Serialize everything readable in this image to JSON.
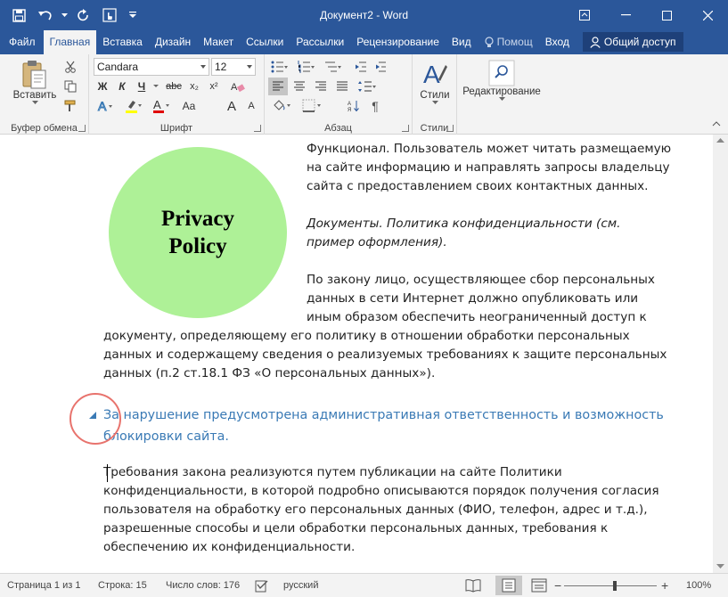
{
  "window": {
    "title": "Документ2 - Word",
    "controls": [
      "restore-ribbon-icon",
      "minimize-icon",
      "maximize-icon",
      "close-icon"
    ]
  },
  "quick_access": [
    "save-icon",
    "undo-icon",
    "redo-icon",
    "touch-mode-icon",
    "customize-icon"
  ],
  "tabs": {
    "file": "Файл",
    "home": "Главная",
    "insert": "Вставка",
    "design": "Дизайн",
    "layout": "Макет",
    "references": "Ссылки",
    "mailings": "Рассылки",
    "review": "Рецензирование",
    "view": "Вид",
    "tell_me": "Помощ",
    "sign_in": "Вход",
    "share": "Общий доступ"
  },
  "ribbon": {
    "clipboard": {
      "paste": "Вставить",
      "label": "Буфер обмена"
    },
    "font": {
      "name": "Candara",
      "size": "12",
      "label": "Шрифт",
      "bold": "Ж",
      "italic": "К",
      "underline": "Ч",
      "strike": "abc",
      "subscript": "x₂",
      "superscript": "x²",
      "grow": "A",
      "shrink": "A",
      "case": "Aa"
    },
    "paragraph": {
      "label": "Абзац"
    },
    "styles": {
      "button": "Стили",
      "label": "Стили"
    },
    "editing": {
      "button": "Редактирование"
    }
  },
  "document": {
    "image_text": [
      "Privacy",
      "Policy"
    ],
    "para1": [
      "Функционал. Пользователь может читать размещаемую",
      "на сайте информацию и направлять запросы владельцу",
      "сайта с предоставлением своих контактных данных."
    ],
    "para2": [
      "Документы. Политика конфиденциальности (см.",
      "пример оформления)."
    ],
    "para3": [
      "По закону лицо, осуществляющее сбор персональных",
      "данных в сети Интернет должно опубликовать или",
      "иным образом обеспечить неограниченный доступ к",
      "документу, определяющему его политику в отношении обработки персональных",
      "данных и содержащему сведения о реализуемых требованиях к защите персональных",
      "данных (п.2 ст.18.1 ФЗ «О персональных данных»)."
    ],
    "heading": [
      "За нарушение предусмотрена административная ответственность и возможность",
      "блокировки сайта."
    ],
    "para4": [
      "Требования закона реализуются путем публикации на сайте Политики",
      "конфиденциальности, в которой подробно описываются порядок получения согласия",
      "пользователя на обработку его персональных данных (ФИО, телефон, адрес и т.д.),",
      "разрешенные способы и цели обработки персональных данных, требования к",
      "обеспечению их конфиденциальности."
    ]
  },
  "status": {
    "page": "Страница 1 из 1",
    "line": "Строка: 15",
    "words": "Число слов: 176",
    "language": "русский",
    "zoom": "100%"
  },
  "colors": {
    "accent": "#2b579a",
    "heading": "#3a7ab5",
    "image_fill": "#aef197",
    "annotation": "#e8736d"
  }
}
